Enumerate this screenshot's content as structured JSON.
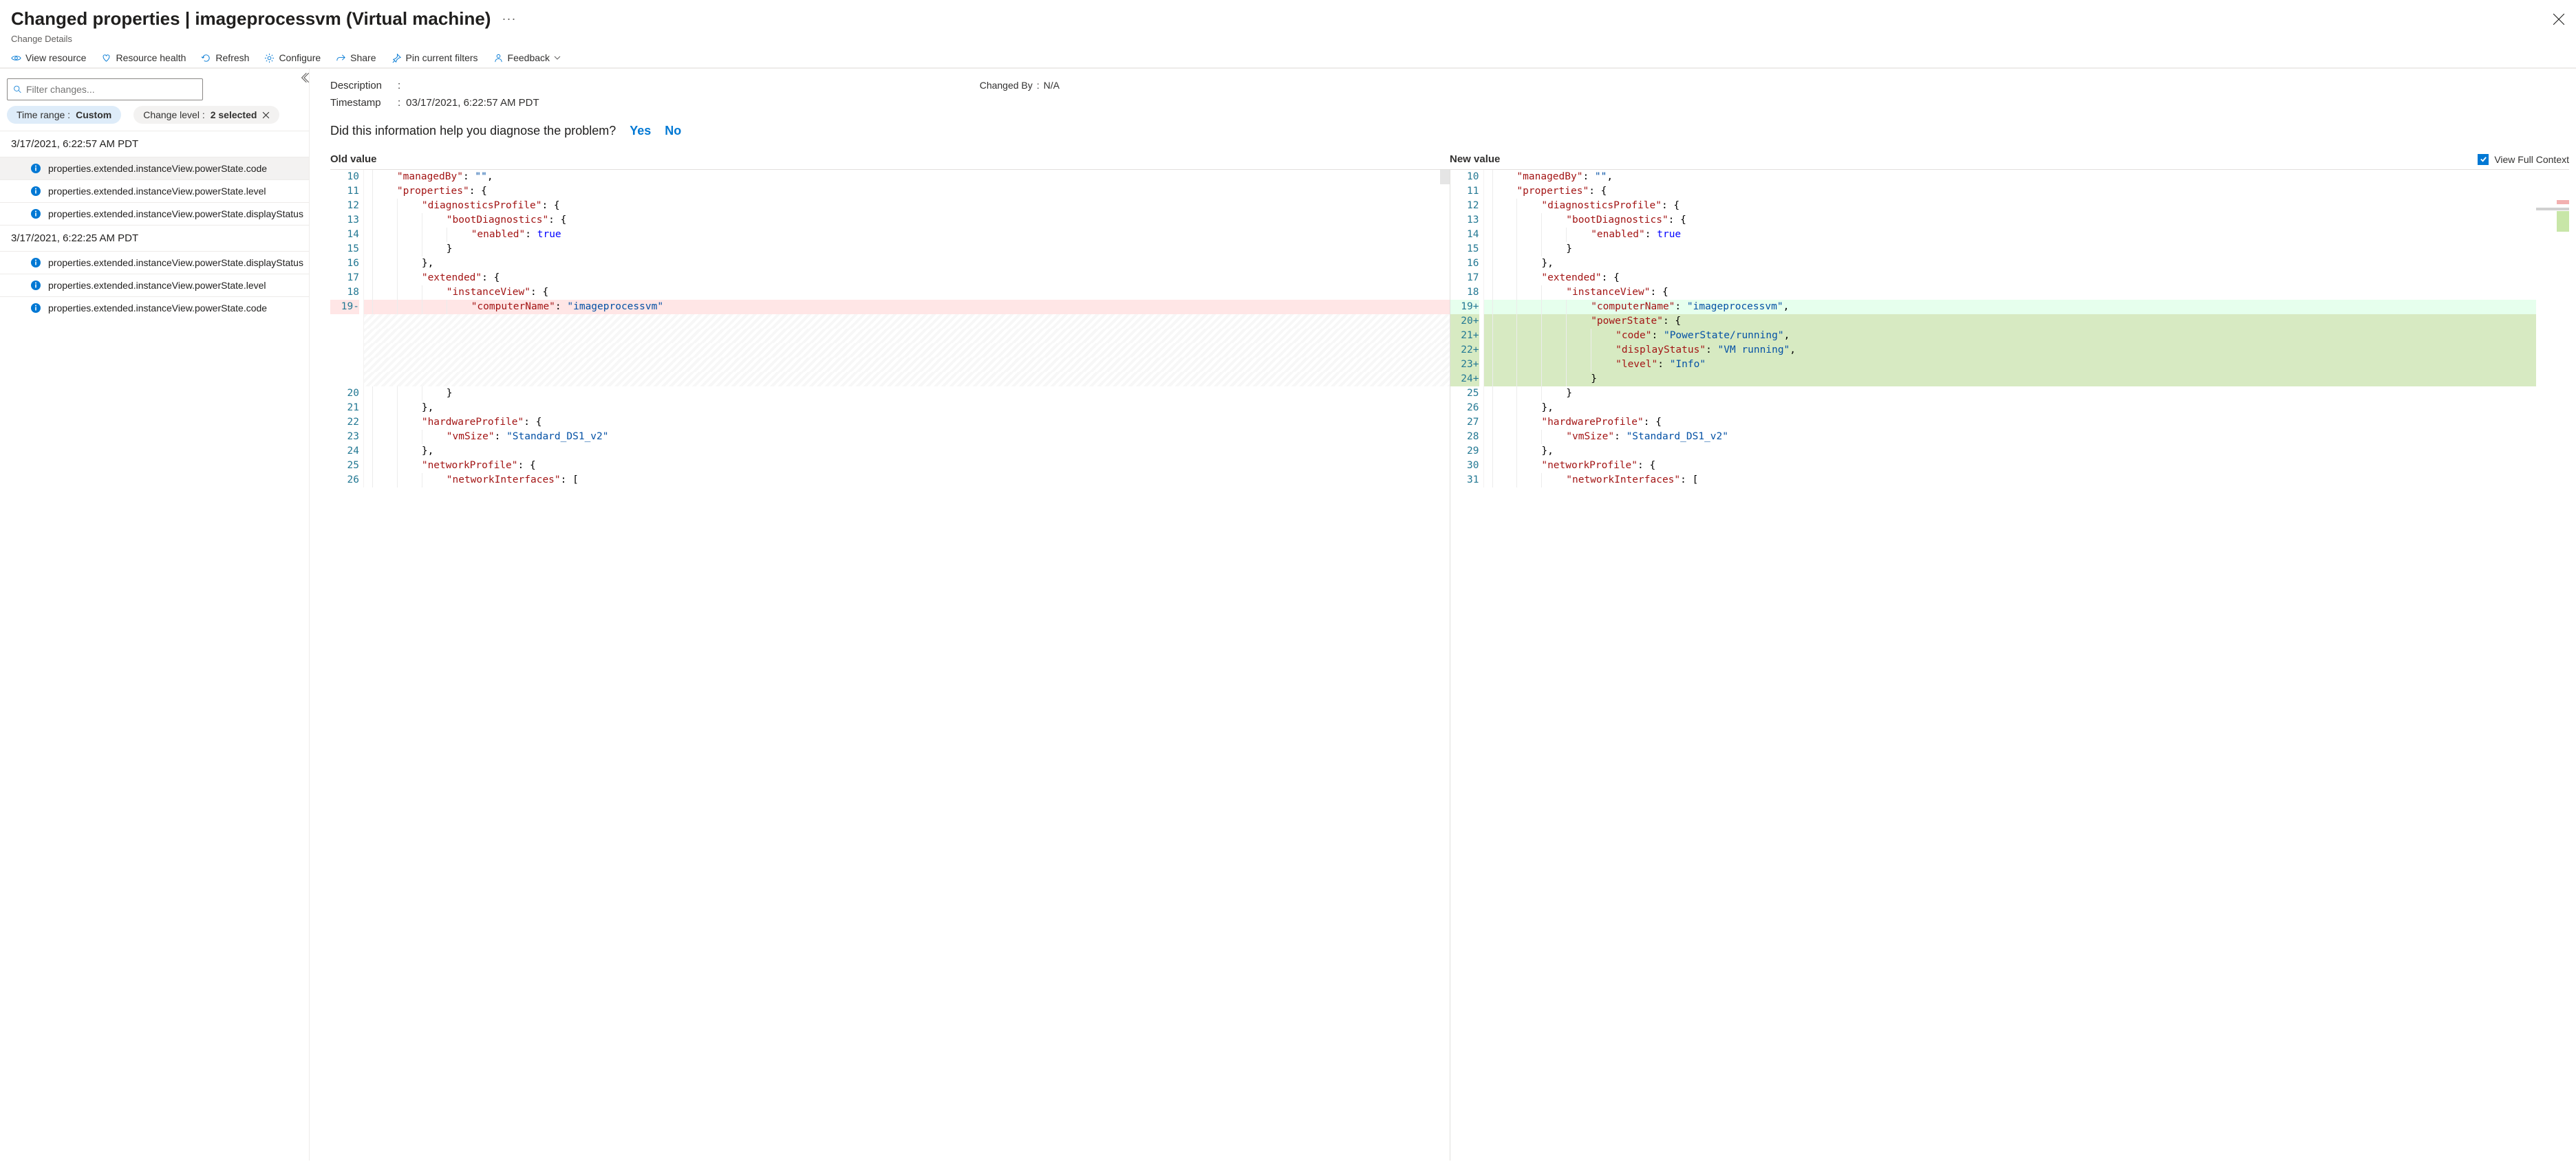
{
  "header": {
    "title": "Changed properties | imageprocessvm (Virtual machine)",
    "subtitle": "Change Details"
  },
  "toolbar": {
    "view_resource": "View resource",
    "resource_health": "Resource health",
    "refresh": "Refresh",
    "configure": "Configure",
    "share": "Share",
    "pin": "Pin current filters",
    "feedback": "Feedback"
  },
  "sidebar": {
    "filter_placeholder": "Filter changes...",
    "pill_time_label": "Time range : ",
    "pill_time_value": "Custom",
    "pill_level_label": "Change level : ",
    "pill_level_value": "2 selected",
    "groups": [
      {
        "time": "3/17/2021, 6:22:57 AM PDT",
        "items": [
          "properties.extended.instanceView.powerState.code",
          "properties.extended.instanceView.powerState.level",
          "properties.extended.instanceView.powerState.displayStatus"
        ]
      },
      {
        "time": "3/17/2021, 6:22:25 AM PDT",
        "items": [
          "properties.extended.instanceView.powerState.displayStatus",
          "properties.extended.instanceView.powerState.level",
          "properties.extended.instanceView.powerState.code"
        ]
      }
    ]
  },
  "details": {
    "description_label": "Description",
    "description": "",
    "timestamp_label": "Timestamp",
    "timestamp": "03/17/2021, 6:22:57 AM PDT",
    "changedby_label": "Changed By",
    "changedby": "N/A",
    "feedback_q": "Did this information help you diagnose the problem?",
    "yes": "Yes",
    "no": "No",
    "old_value": "Old value",
    "new_value": "New value",
    "view_full_context": "View Full Context"
  },
  "diff": {
    "old": [
      {
        "n": 10,
        "seg": [
          [
            "key",
            "\"managedBy\""
          ],
          [
            "punc",
            ": "
          ],
          [
            "str",
            "\"\""
          ],
          [
            "punc",
            ","
          ]
        ],
        "indent": 1
      },
      {
        "n": 11,
        "seg": [
          [
            "key",
            "\"properties\""
          ],
          [
            "punc",
            ": {"
          ]
        ],
        "indent": 1
      },
      {
        "n": 12,
        "seg": [
          [
            "key",
            "\"diagnosticsProfile\""
          ],
          [
            "punc",
            ": {"
          ]
        ],
        "indent": 2
      },
      {
        "n": 13,
        "seg": [
          [
            "key",
            "\"bootDiagnostics\""
          ],
          [
            "punc",
            ": {"
          ]
        ],
        "indent": 3
      },
      {
        "n": 14,
        "seg": [
          [
            "key",
            "\"enabled\""
          ],
          [
            "punc",
            ": "
          ],
          [
            "kw",
            "true"
          ]
        ],
        "indent": 4
      },
      {
        "n": 15,
        "seg": [
          [
            "punc",
            "}"
          ]
        ],
        "indent": 3
      },
      {
        "n": 16,
        "seg": [
          [
            "punc",
            "},"
          ]
        ],
        "indent": 2
      },
      {
        "n": 17,
        "seg": [
          [
            "key",
            "\"extended\""
          ],
          [
            "punc",
            ": {"
          ]
        ],
        "indent": 2
      },
      {
        "n": 18,
        "seg": [
          [
            "key",
            "\"instanceView\""
          ],
          [
            "punc",
            ": {"
          ]
        ],
        "indent": 3
      },
      {
        "n": 19,
        "cls": "removed",
        "mark": "-",
        "seg": [
          [
            "key",
            "\"computerName\""
          ],
          [
            "punc",
            ": "
          ],
          [
            "str",
            "\"imageprocessvm\""
          ]
        ],
        "indent": 4
      },
      {
        "cls": "hatch"
      },
      {
        "cls": "hatch"
      },
      {
        "cls": "hatch"
      },
      {
        "cls": "hatch"
      },
      {
        "cls": "hatch"
      },
      {
        "n": 20,
        "seg": [
          [
            "punc",
            "}"
          ]
        ],
        "indent": 3
      },
      {
        "n": 21,
        "seg": [
          [
            "punc",
            "},"
          ]
        ],
        "indent": 2
      },
      {
        "n": 22,
        "seg": [
          [
            "key",
            "\"hardwareProfile\""
          ],
          [
            "punc",
            ": {"
          ]
        ],
        "indent": 2
      },
      {
        "n": 23,
        "seg": [
          [
            "key",
            "\"vmSize\""
          ],
          [
            "punc",
            ": "
          ],
          [
            "str",
            "\"Standard_DS1_v2\""
          ]
        ],
        "indent": 3
      },
      {
        "n": 24,
        "seg": [
          [
            "punc",
            "},"
          ]
        ],
        "indent": 2
      },
      {
        "n": 25,
        "seg": [
          [
            "key",
            "\"networkProfile\""
          ],
          [
            "punc",
            ": {"
          ]
        ],
        "indent": 2
      },
      {
        "n": 26,
        "seg": [
          [
            "key",
            "\"networkInterfaces\""
          ],
          [
            "punc",
            ": ["
          ]
        ],
        "indent": 3
      }
    ],
    "new": [
      {
        "n": 10,
        "seg": [
          [
            "key",
            "\"managedBy\""
          ],
          [
            "punc",
            ": "
          ],
          [
            "str",
            "\"\""
          ],
          [
            "punc",
            ","
          ]
        ],
        "indent": 1
      },
      {
        "n": 11,
        "seg": [
          [
            "key",
            "\"properties\""
          ],
          [
            "punc",
            ": {"
          ]
        ],
        "indent": 1
      },
      {
        "n": 12,
        "seg": [
          [
            "key",
            "\"diagnosticsProfile\""
          ],
          [
            "punc",
            ": {"
          ]
        ],
        "indent": 2
      },
      {
        "n": 13,
        "seg": [
          [
            "key",
            "\"bootDiagnostics\""
          ],
          [
            "punc",
            ": {"
          ]
        ],
        "indent": 3
      },
      {
        "n": 14,
        "seg": [
          [
            "key",
            "\"enabled\""
          ],
          [
            "punc",
            ": "
          ],
          [
            "kw",
            "true"
          ]
        ],
        "indent": 4
      },
      {
        "n": 15,
        "seg": [
          [
            "punc",
            "}"
          ]
        ],
        "indent": 3
      },
      {
        "n": 16,
        "seg": [
          [
            "punc",
            "},"
          ]
        ],
        "indent": 2
      },
      {
        "n": 17,
        "seg": [
          [
            "key",
            "\"extended\""
          ],
          [
            "punc",
            ": {"
          ]
        ],
        "indent": 2
      },
      {
        "n": 18,
        "seg": [
          [
            "key",
            "\"instanceView\""
          ],
          [
            "punc",
            ": {"
          ]
        ],
        "indent": 3
      },
      {
        "n": 19,
        "cls": "added",
        "mark": "+",
        "seg": [
          [
            "key",
            "\"computerName\""
          ],
          [
            "punc",
            ": "
          ],
          [
            "str",
            "\"imageprocessvm\""
          ],
          [
            "punc",
            ","
          ]
        ],
        "indent": 4
      },
      {
        "n": 20,
        "cls": "added-strong",
        "mark": "+",
        "seg": [
          [
            "key",
            "\"powerState\""
          ],
          [
            "punc",
            ": {"
          ]
        ],
        "indent": 4
      },
      {
        "n": 21,
        "cls": "added-strong",
        "mark": "+",
        "seg": [
          [
            "key",
            "\"code\""
          ],
          [
            "punc",
            ": "
          ],
          [
            "str",
            "\"PowerState/running\""
          ],
          [
            "punc",
            ","
          ]
        ],
        "indent": 5
      },
      {
        "n": 22,
        "cls": "added-strong",
        "mark": "+",
        "seg": [
          [
            "key",
            "\"displayStatus\""
          ],
          [
            "punc",
            ": "
          ],
          [
            "str",
            "\"VM running\""
          ],
          [
            "punc",
            ","
          ]
        ],
        "indent": 5
      },
      {
        "n": 23,
        "cls": "added-strong",
        "mark": "+",
        "seg": [
          [
            "key",
            "\"level\""
          ],
          [
            "punc",
            ": "
          ],
          [
            "str",
            "\"Info\""
          ]
        ],
        "indent": 5
      },
      {
        "n": 24,
        "cls": "added-strong",
        "mark": "+",
        "seg": [
          [
            "punc",
            "}"
          ]
        ],
        "indent": 4
      },
      {
        "n": 25,
        "seg": [
          [
            "punc",
            "}"
          ]
        ],
        "indent": 3
      },
      {
        "n": 26,
        "seg": [
          [
            "punc",
            "},"
          ]
        ],
        "indent": 2
      },
      {
        "n": 27,
        "seg": [
          [
            "key",
            "\"hardwareProfile\""
          ],
          [
            "punc",
            ": {"
          ]
        ],
        "indent": 2
      },
      {
        "n": 28,
        "seg": [
          [
            "key",
            "\"vmSize\""
          ],
          [
            "punc",
            ": "
          ],
          [
            "str",
            "\"Standard_DS1_v2\""
          ]
        ],
        "indent": 3
      },
      {
        "n": 29,
        "seg": [
          [
            "punc",
            "},"
          ]
        ],
        "indent": 2
      },
      {
        "n": 30,
        "seg": [
          [
            "key",
            "\"networkProfile\""
          ],
          [
            "punc",
            ": {"
          ]
        ],
        "indent": 2
      },
      {
        "n": 31,
        "seg": [
          [
            "key",
            "\"networkInterfaces\""
          ],
          [
            "punc",
            ": ["
          ]
        ],
        "indent": 3
      }
    ]
  }
}
